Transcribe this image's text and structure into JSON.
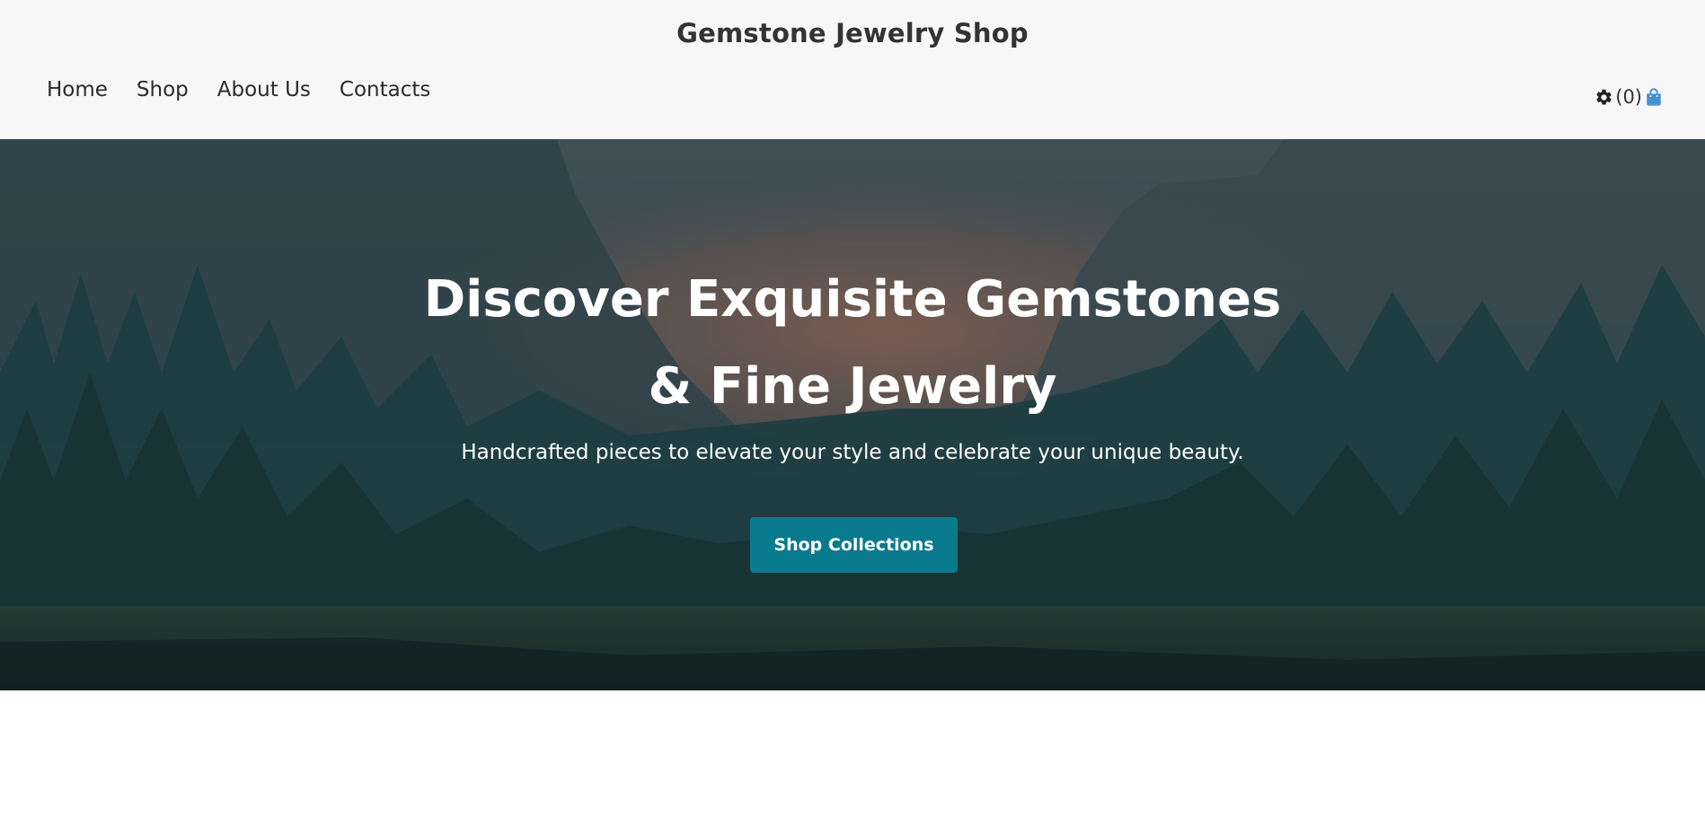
{
  "header": {
    "site_title": "Gemstone Jewelry Shop",
    "nav": [
      {
        "label": "Home"
      },
      {
        "label": "Shop"
      },
      {
        "label": "About Us"
      },
      {
        "label": "Contacts"
      }
    ],
    "cart_count": "(0)",
    "icons": {
      "settings": "gear-icon",
      "cart": "shopping-bag-icon"
    },
    "cart_icon_color": "#4a8fd6"
  },
  "hero": {
    "title_line1": "Discover Exquisite Gemstones",
    "title_line2": "& Fine Jewelry",
    "subtitle": "Handcrafted pieces to elevate your style and celebrate your unique beauty.",
    "cta_label": "Shop Collections",
    "cta_color": "#0a7a8f"
  }
}
